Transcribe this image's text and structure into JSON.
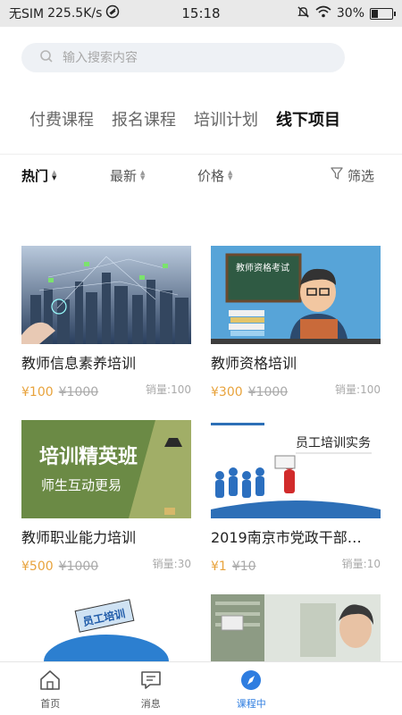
{
  "statusbar": {
    "sim": "无SIM",
    "speed": "225.5K/s",
    "time": "15:18",
    "battery": "30%",
    "battery_level": 0.3,
    "icons": [
      "no-sim-icon",
      "data-icon",
      "mute-icon",
      "wifi-icon",
      "battery-icon"
    ]
  },
  "search": {
    "placeholder": "输入搜索内容",
    "icon": "search-icon"
  },
  "tabs": [
    {
      "label": "付费课程"
    },
    {
      "label": "报名课程"
    },
    {
      "label": "培训计划"
    },
    {
      "label": "线下项目"
    }
  ],
  "active_tab": "线下项目",
  "filters": {
    "hot": "热门",
    "newest": "最新",
    "price": "价格",
    "filter": "筛选"
  },
  "courses": [
    {
      "title": "教师信息素养培训",
      "price": "¥100",
      "old_price": "¥1000",
      "sales": "销量:100"
    },
    {
      "title": "教师资格培训",
      "price": "¥300",
      "old_price": "¥1000",
      "sales": "销量:100",
      "image_text": "教师资格考试"
    },
    {
      "title": "教师职业能力培训",
      "price": "¥500",
      "old_price": "¥1000",
      "sales": "销量:30",
      "image_text": "培训精英班",
      "image_subtext": "师生互动更易"
    },
    {
      "title": "2019南京市党政干部…",
      "price": "¥1",
      "old_price": "¥10",
      "sales": "销量:10",
      "image_text": "员工培训实务"
    },
    {
      "title": "",
      "image_text": "员工培训"
    },
    {
      "title": ""
    }
  ],
  "tabbar": [
    {
      "label": "首页",
      "icon": "home-icon"
    },
    {
      "label": "消息",
      "icon": "message-icon"
    },
    {
      "label": "课程中",
      "icon": "compass-icon"
    },
    {
      "label": "",
      "icon": ""
    }
  ],
  "colors": {
    "accent": "#2e7de0",
    "price": "#e8a33c",
    "search_bg": "#eef1f5"
  }
}
